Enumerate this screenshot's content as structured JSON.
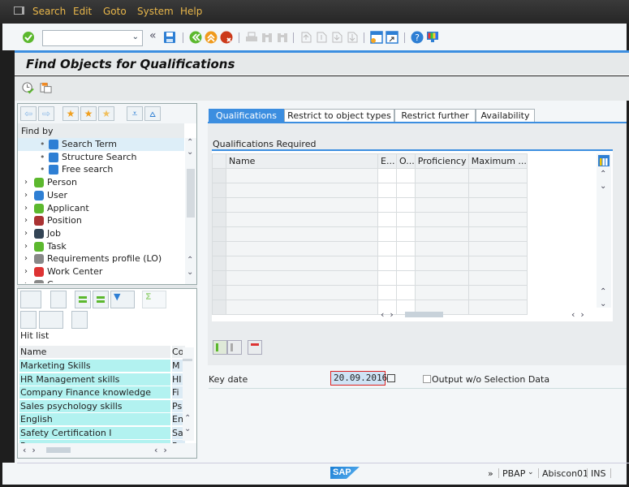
{
  "menubar": {
    "items": [
      {
        "label": "Search",
        "hotkey": "S"
      },
      {
        "label": "Edit",
        "hotkey": "E"
      },
      {
        "label": "Goto",
        "hotkey": "G"
      },
      {
        "label": "System",
        "hotkey": "y"
      },
      {
        "label": "Help",
        "hotkey": "H"
      }
    ]
  },
  "toolbar": {
    "command_field": {
      "value": "",
      "placeholder": ""
    },
    "collapse_glyph": "«"
  },
  "title": "Find Objects for Qualifications",
  "tree": {
    "header": "Find by",
    "items": [
      {
        "label": "Search Term",
        "level": 1,
        "icon": "binoculars-icon",
        "selected": true
      },
      {
        "label": "Structure Search",
        "level": 1,
        "icon": "binoculars-icon"
      },
      {
        "label": "Free search",
        "level": 1,
        "icon": "binoculars-icon"
      },
      {
        "label": "Person",
        "level": 0,
        "icon": "person-icon"
      },
      {
        "label": "User",
        "level": 0,
        "icon": "user-icon"
      },
      {
        "label": "Applicant",
        "level": 0,
        "icon": "applicant-icon"
      },
      {
        "label": "Position",
        "level": 0,
        "icon": "position-icon"
      },
      {
        "label": "Job",
        "level": 0,
        "icon": "job-icon"
      },
      {
        "label": "Task",
        "level": 0,
        "icon": "task-icon"
      },
      {
        "label": "Requirements profile (LO)",
        "level": 0,
        "icon": "requirements-profile-icon"
      },
      {
        "label": "Work Center",
        "level": 0,
        "icon": "work-center-icon"
      },
      {
        "label": "C...",
        "level": 0,
        "icon": "course-icon"
      }
    ]
  },
  "hitlist": {
    "label": "Hit list",
    "columns": [
      "Name",
      "Co"
    ],
    "rows": [
      {
        "name": "Marketing Skills",
        "code": "M"
      },
      {
        "name": "HR Management skills",
        "code": "HI"
      },
      {
        "name": "Company Finance knowledge",
        "code": "Fi"
      },
      {
        "name": "Sales psychology skills",
        "code": "Ps"
      },
      {
        "name": "English",
        "code": "En"
      },
      {
        "name": "Safety Certification I",
        "code": "Sa"
      },
      {
        "name": "P...",
        "code": "P"
      }
    ]
  },
  "tabs": [
    {
      "label": "Qualifications",
      "active": true
    },
    {
      "label": "Restrict to object types",
      "active": false
    },
    {
      "label": "Restrict further",
      "active": false
    },
    {
      "label": "Availability",
      "active": false
    }
  ],
  "qualifications": {
    "section_title": "Qualifications Required",
    "columns": [
      "Name",
      "E...",
      "O...",
      "Proficiency",
      "Maximum ..."
    ],
    "row_count": 10
  },
  "keydate": {
    "label": "Key date",
    "value": "20.09.2016"
  },
  "output_checkbox": {
    "label": "Output w/o Selection Data",
    "checked": false
  },
  "statusbar": {
    "logo": "SAP",
    "expand": "»",
    "transaction": "PBAP",
    "server": "Abiscon01",
    "mode": "INS"
  }
}
